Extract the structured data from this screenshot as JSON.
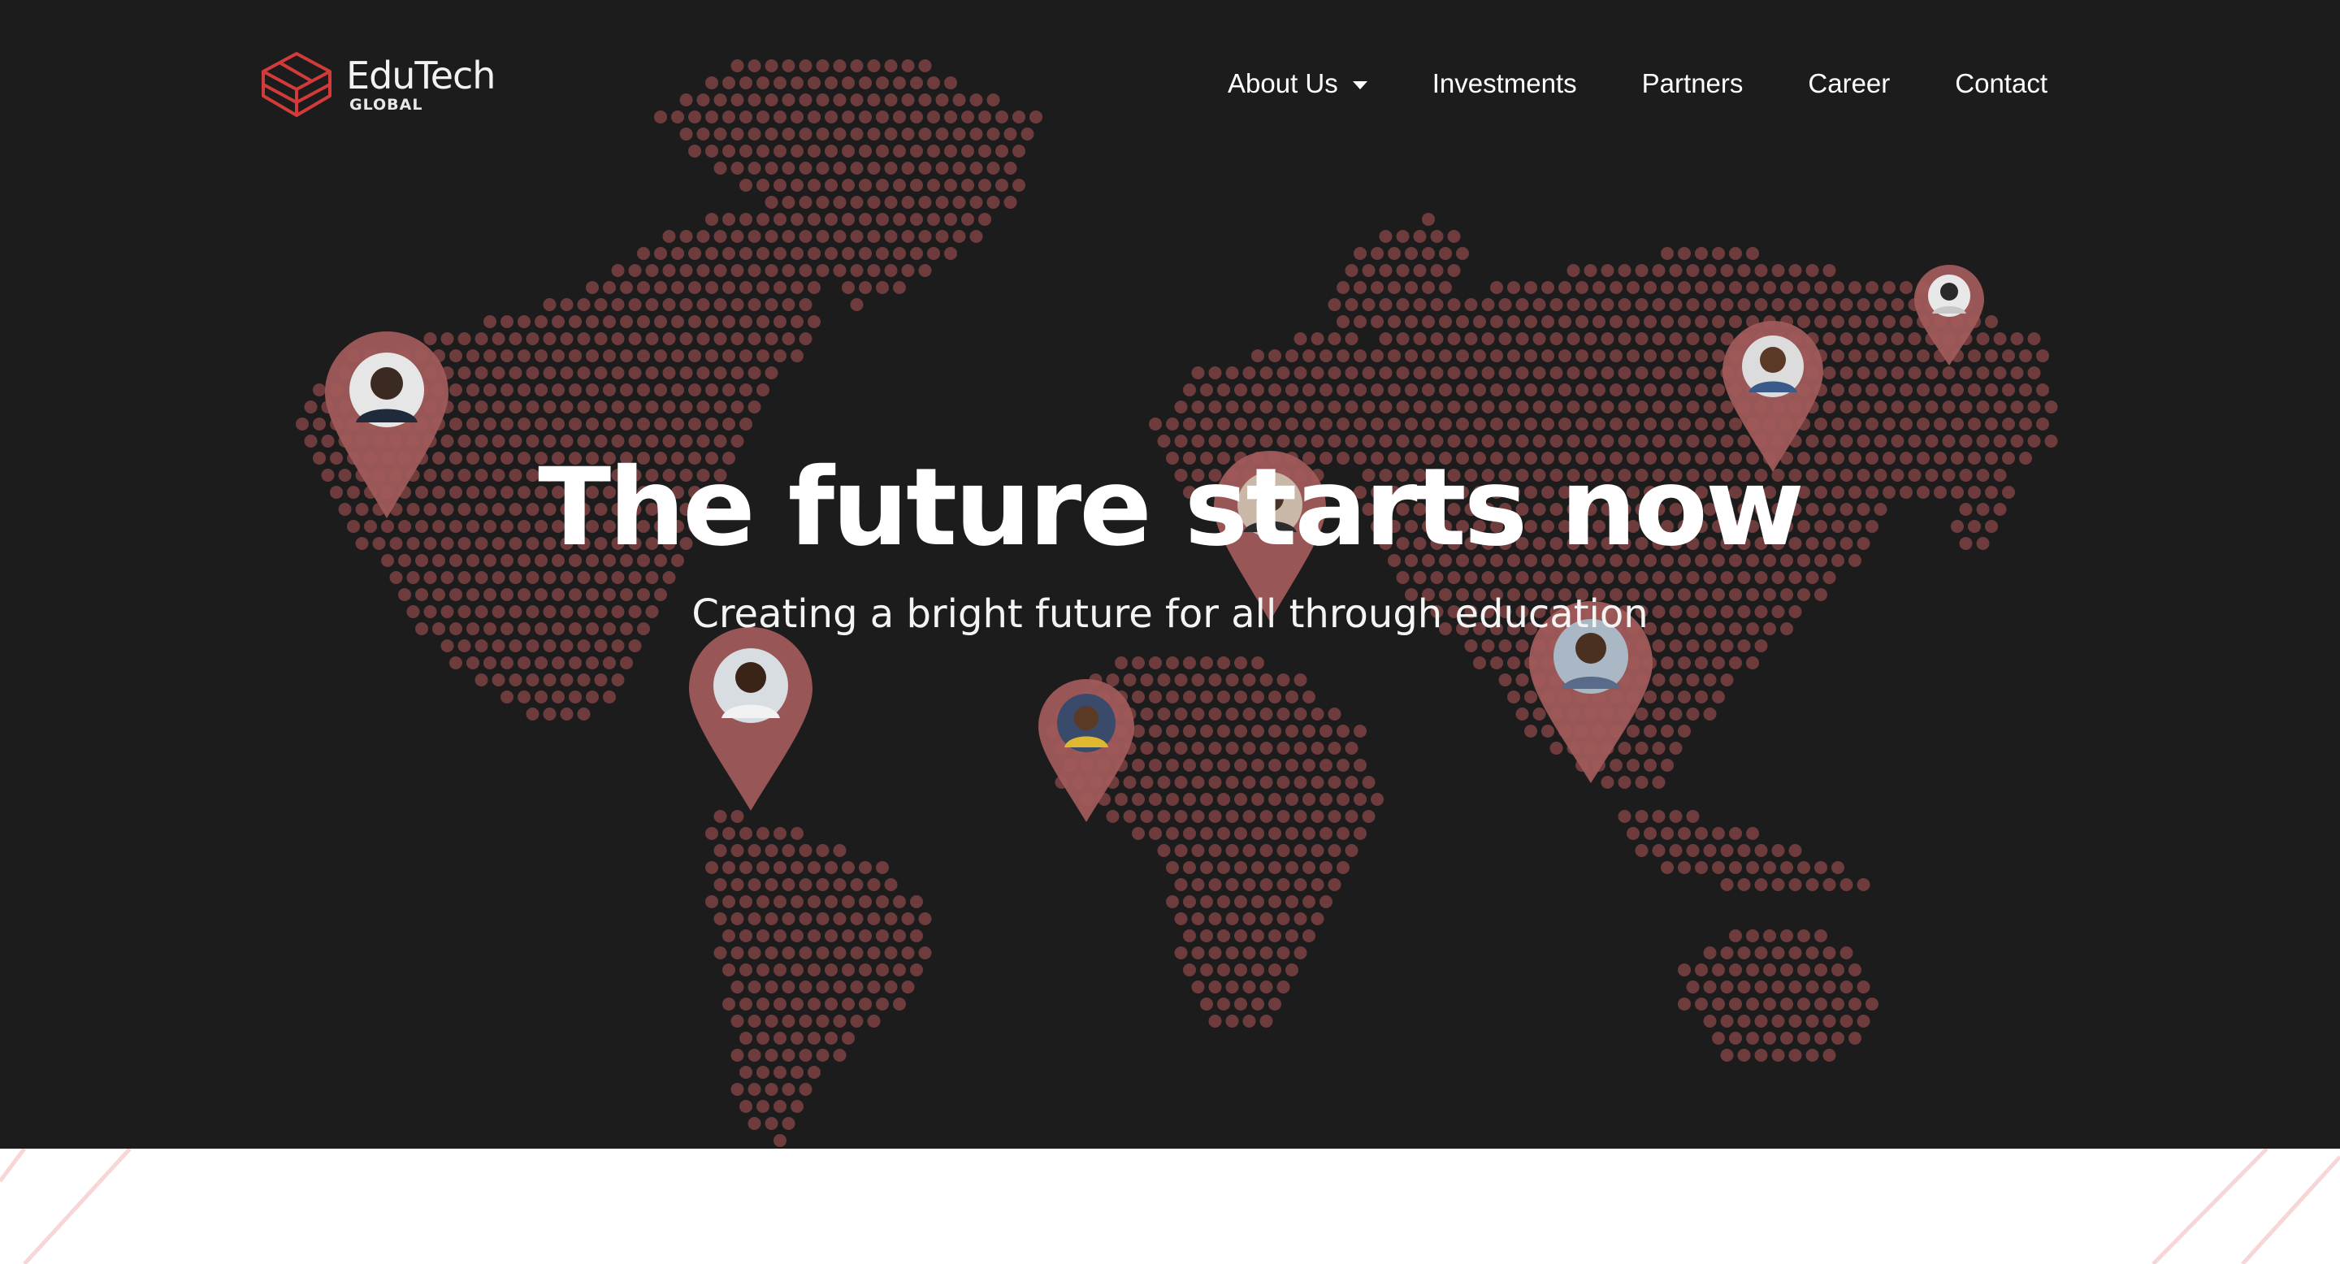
{
  "brand": {
    "name": "EduTech",
    "tagline": "GLOBAL",
    "accent": "#d33b3b"
  },
  "nav": {
    "items": [
      {
        "label": "About Us",
        "has_dropdown": true
      },
      {
        "label": "Investments"
      },
      {
        "label": "Partners"
      },
      {
        "label": "Career"
      },
      {
        "label": "Contact"
      }
    ]
  },
  "hero": {
    "headline_regular_1": "The",
    "headline_bold": "future",
    "headline_regular_2": "starts now",
    "subheadline": "Creating a bright future for all through education",
    "background": "#1c1c1c",
    "dot_color": "#8a4747",
    "pin_color": "#a35b5b"
  }
}
